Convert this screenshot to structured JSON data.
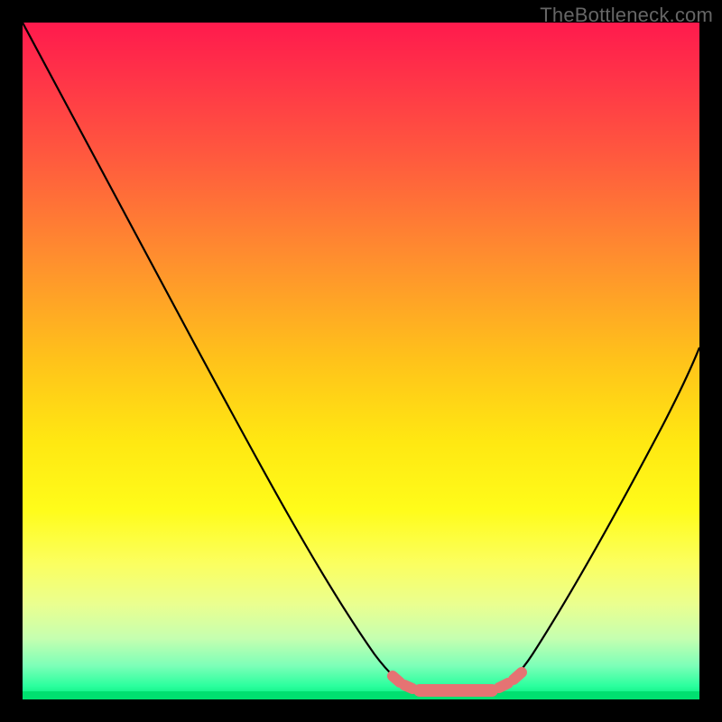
{
  "watermark": "TheBottleneck.com",
  "colors": {
    "accent_pink": "#e57373",
    "curve": "#000000",
    "bottom_band": "#00e070"
  },
  "chart_data": {
    "type": "line",
    "title": "",
    "xlabel": "",
    "ylabel": "",
    "xlim": [
      0,
      100
    ],
    "ylim": [
      0,
      100
    ],
    "grid": false,
    "legend": false,
    "annotations": [
      "TheBottleneck.com"
    ],
    "series": [
      {
        "name": "bottleneck-curve",
        "x": [
          0,
          10,
          20,
          30,
          40,
          48,
          52,
          56,
          58,
          60,
          64,
          68,
          72,
          80,
          90,
          100
        ],
        "values": [
          100,
          83,
          66,
          49,
          32,
          18,
          11,
          4,
          2,
          1,
          1,
          1,
          3,
          13,
          30,
          52
        ]
      }
    ],
    "highlight_range_x": [
      55,
      71
    ],
    "notes": "V-shaped curve over a vertical red-to-green heat gradient; trough near x≈60–64 at y≈1. Pink rounded segments mark the flat bottom region and short dashes on each side of it."
  }
}
